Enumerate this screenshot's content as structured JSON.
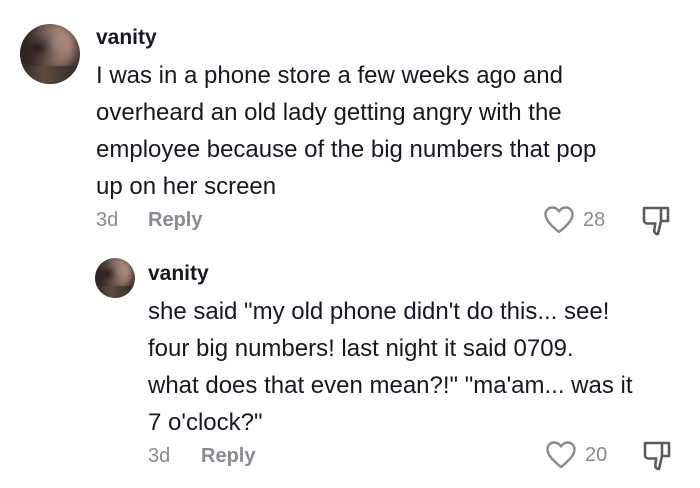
{
  "comments": [
    {
      "username": "vanity",
      "text_lines": [
        "I was in a phone store a few weeks ago and",
        "overheard an old lady getting angry with the",
        "employee because of the big numbers that pop",
        "up on her screen"
      ],
      "time": "3d",
      "reply_label": "Reply",
      "likes": "28",
      "avatar_icon": "user-avatar",
      "like_icon": "heart-outline-icon",
      "dislike_icon": "thumbs-down-icon"
    },
    {
      "username": "vanity",
      "text_lines": [
        "she said \"my old phone didn't do this... see!",
        "four big numbers! last night it said 0709.",
        "what does that even mean?!\" \"ma'am... was it",
        "7 o'clock?\""
      ],
      "time": "3d",
      "reply_label": "Reply",
      "likes": "20",
      "avatar_icon": "user-avatar",
      "like_icon": "heart-outline-icon",
      "dislike_icon": "thumbs-down-icon"
    }
  ]
}
